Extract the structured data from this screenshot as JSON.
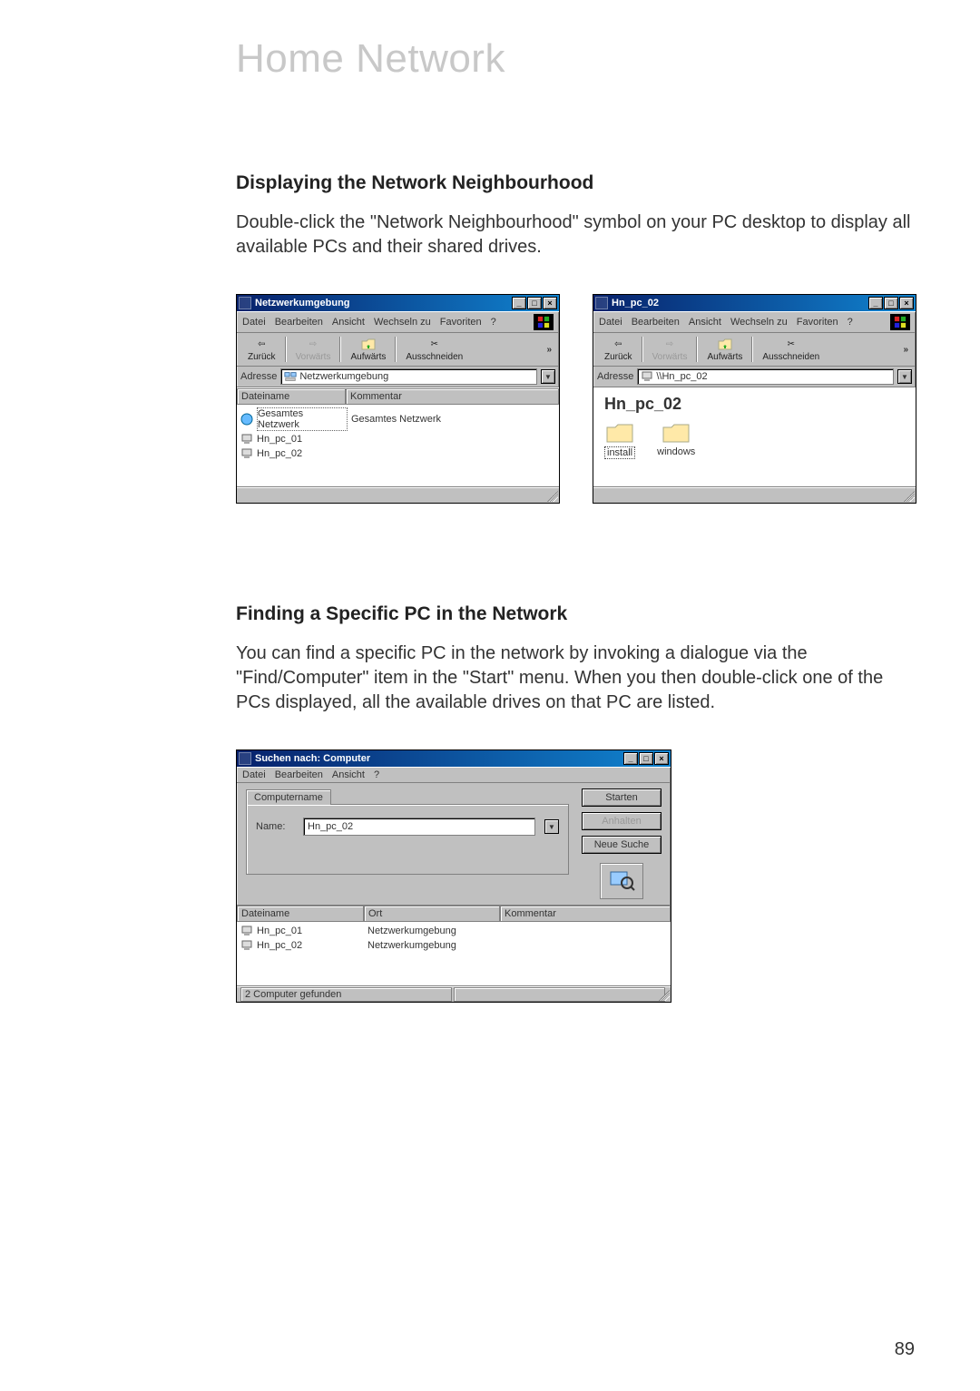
{
  "page": {
    "title": "Home Network",
    "number": "89"
  },
  "section1": {
    "heading": "Displaying the Network Neighbourhood",
    "body": "Double-click the \"Network Neighbourhood\" symbol on your PC desktop to display all available PCs and their shared drives."
  },
  "section2": {
    "heading": "Finding a Specific PC in the Network",
    "body": "You can find a specific PC in the network by invoking a dialogue via the \"Find/Computer\" item in the \"Start\" menu. When you then double-click one of the PCs displayed, all the available drives on that PC are listed."
  },
  "menus": {
    "datei": "Datei",
    "bearbeiten": "Bearbeiten",
    "ansicht": "Ansicht",
    "wechseln": "Wechseln zu",
    "favoriten": "Favoriten",
    "help": "?"
  },
  "toolbar": {
    "back": "Zurück",
    "forward": "Vorwärts",
    "up": "Aufwärts",
    "cut": "Ausschneiden",
    "overflow": "»"
  },
  "addr_label": "Adresse",
  "win1": {
    "title": "Netzwerkumgebung",
    "addr": "Netzwerkumgebung",
    "col_name": "Dateiname",
    "col_comment": "Kommentar",
    "rows": [
      {
        "name": "Gesamtes Netzwerk",
        "comment": "Gesamtes Netzwerk"
      },
      {
        "name": "Hn_pc_01",
        "comment": ""
      },
      {
        "name": "Hn_pc_02",
        "comment": ""
      }
    ]
  },
  "win2": {
    "title": "Hn_pc_02",
    "addr": "\\\\Hn_pc_02",
    "heading": "Hn_pc_02",
    "folders": [
      {
        "label": "install"
      },
      {
        "label": "windows"
      }
    ]
  },
  "win3": {
    "title": "Suchen nach: Computer",
    "tab": "Computername",
    "field_label": "Name:",
    "field_value": "Hn_pc_02",
    "btn_start": "Starten",
    "btn_stop": "Anhalten",
    "btn_new": "Neue Suche",
    "col_name": "Dateiname",
    "col_loc": "Ort",
    "col_comment": "Kommentar",
    "rows": [
      {
        "name": "Hn_pc_01",
        "loc": "Netzwerkumgebung"
      },
      {
        "name": "Hn_pc_02",
        "loc": "Netzwerkumgebung"
      }
    ],
    "status": "2 Computer gefunden"
  }
}
